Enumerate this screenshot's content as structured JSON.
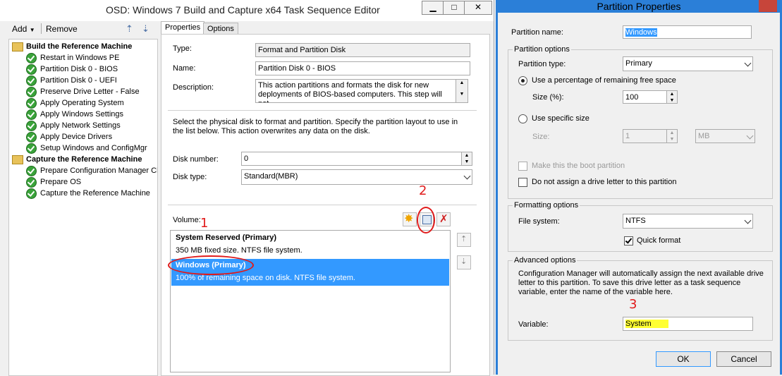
{
  "editor": {
    "title": "OSD: Windows 7 Build and Capture x64 Task Sequence Editor",
    "window_buttons": [
      "▁",
      "□",
      "✕"
    ],
    "toolbar": {
      "add_label": "Add",
      "remove_label": "Remove"
    },
    "tree": {
      "items": [
        {
          "label": "Build the Reference Machine",
          "type": "group"
        },
        {
          "label": "Restart in Windows PE",
          "type": "step"
        },
        {
          "label": "Partition Disk 0 - BIOS",
          "type": "step"
        },
        {
          "label": "Partition Disk 0 - UEFI",
          "type": "step"
        },
        {
          "label": "Preserve Drive Letter - False",
          "type": "step"
        },
        {
          "label": "Apply Operating System",
          "type": "step"
        },
        {
          "label": "Apply Windows Settings",
          "type": "step"
        },
        {
          "label": "Apply Network Settings",
          "type": "step"
        },
        {
          "label": "Apply Device Drivers",
          "type": "step"
        },
        {
          "label": "Setup Windows and ConfigMgr",
          "type": "step"
        },
        {
          "label": "Capture the Reference Machine",
          "type": "group"
        },
        {
          "label": "Prepare Configuration Manager Cli",
          "type": "step"
        },
        {
          "label": "Prepare OS",
          "type": "step"
        },
        {
          "label": "Capture the Reference Machine",
          "type": "step"
        }
      ]
    },
    "tabs": [
      "Properties",
      "Options"
    ],
    "properties": {
      "type_label": "Type:",
      "type_value": "Format and Partition Disk",
      "name_label": "Name:",
      "name_value": "Partition Disk 0 - BIOS",
      "description_label": "Description:",
      "description_value": "This action partitions and formats the disk for new deployments of BIOS-based computers. This step will not",
      "instructions": "Select the physical disk to format and partition. Specify the partition layout to use in the list below. This action overwrites any data on the disk.",
      "disk_number_label": "Disk number:",
      "disk_number_value": "0",
      "disk_type_label": "Disk type:",
      "disk_type_value": "Standard(MBR)",
      "volume_label": "Volume:",
      "volumes": [
        {
          "title": "System Reserved (Primary)",
          "detail": "350 MB fixed size. NTFS file system."
        },
        {
          "title": "Windows (Primary)",
          "detail": "100% of remaining space on disk. NTFS file system."
        }
      ]
    },
    "annotations": [
      "1",
      "2",
      "3"
    ]
  },
  "dialog": {
    "title": "Partition Properties",
    "partition_name_label": "Partition name:",
    "partition_name_value": "Windows",
    "partition_options_title": "Partition options",
    "partition_type_label": "Partition type:",
    "partition_type_value": "Primary",
    "use_percentage_label": "Use a percentage of remaining free space",
    "size_percent_label": "Size (%):",
    "size_percent_value": "100",
    "use_specific_label": "Use specific size",
    "size_label": "Size:",
    "size_value": "1",
    "size_unit": "MB",
    "boot_partition_label": "Make this the boot partition",
    "no_drive_letter_label": "Do not assign a drive letter to this partition",
    "formatting_title": "Formatting options",
    "file_system_label": "File system:",
    "file_system_value": "NTFS",
    "quick_format_label": "Quick format",
    "advanced_title": "Advanced options",
    "advanced_text": "Configuration Manager will automatically assign the next available drive letter to this partition. To save this drive letter as a task sequence variable, enter the name of the variable here.",
    "variable_label": "Variable:",
    "variable_value": "System",
    "ok_label": "OK",
    "cancel_label": "Cancel"
  },
  "colors": {
    "selection": "#3399ff",
    "annotation": "#e01a1a",
    "highlight": "#ffff33",
    "dialog_border": "#2b7fd8"
  }
}
